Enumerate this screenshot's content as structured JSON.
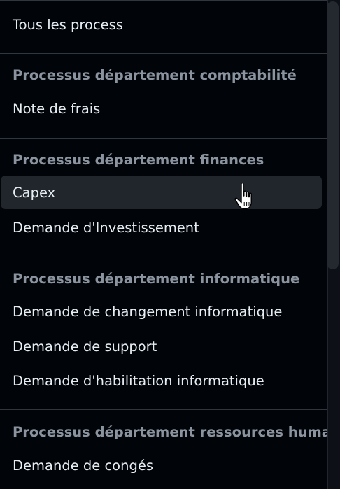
{
  "menu": {
    "all_label": "Tous les process",
    "groups": [
      {
        "title": "Processus département comptabilité",
        "items": [
          {
            "label": "Note de frais"
          }
        ]
      },
      {
        "title": "Processus département finances",
        "items": [
          {
            "label": "Capex",
            "hovered": true
          },
          {
            "label": "Demande d'Investissement"
          }
        ]
      },
      {
        "title": "Processus département informatique",
        "items": [
          {
            "label": "Demande de changement informatique"
          },
          {
            "label": "Demande de support"
          },
          {
            "label": "Demande d'habilitation informatique"
          }
        ]
      },
      {
        "title": "Processus département ressources humaines",
        "items": [
          {
            "label": "Demande de congés"
          }
        ]
      }
    ]
  },
  "colors": {
    "background": "#010409",
    "text": "#e6edf3",
    "group_title": "#8b949e",
    "hover_background": "#21262d",
    "separator": "#30363d"
  },
  "icons": {
    "cursor": "pointer-hand-icon"
  }
}
